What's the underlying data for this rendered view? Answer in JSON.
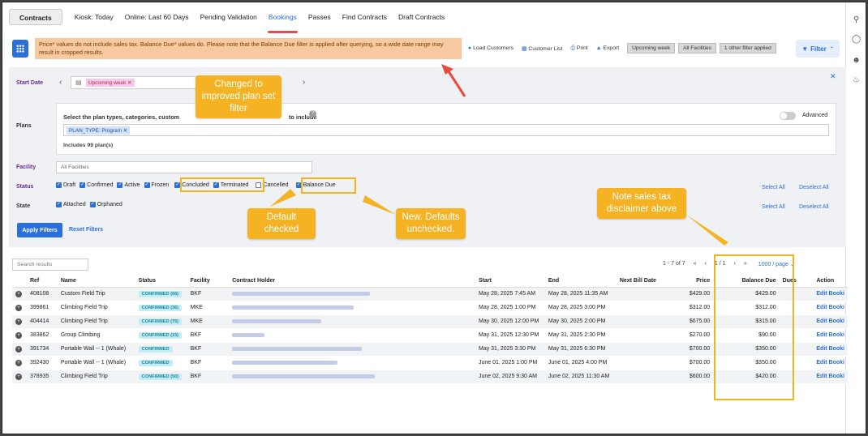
{
  "tabs": [
    "Contracts",
    "Kiosk: Today",
    "Online: Last 60 Days",
    "Pending Validation",
    "Bookings",
    "Passes",
    "Find Contracts",
    "Draft Contracts"
  ],
  "active_tab": "Bookings",
  "notice": "Price* values do not include sales tax. Balance Due* values do. Please note that the Balance Due filter is applied after querying, so a wide date range may result in cropped results.",
  "toolbar": {
    "load_customers": "Load Customers",
    "customer_list": "Customer List",
    "print": "Print",
    "export": "Export",
    "chips": [
      "Upcoming week",
      "All Facilities",
      "1 other filter applied"
    ],
    "filter_label": "Filter"
  },
  "filters": {
    "start_date_label": "Start Date",
    "start_date_value": "Upcoming week",
    "plans_label": "Plans",
    "plans_prompt": "Select the plan types, categories, custom",
    "plans_prompt_tail": "to include",
    "plan_tag": "PLAN_TYPE: Program",
    "plans_count": "Includes 99 plan(s)",
    "advanced_label": "Advanced",
    "facility_label": "Facility",
    "facility_value": "All Facilities",
    "status_label": "Status",
    "status_options": [
      {
        "label": "Draft",
        "checked": true
      },
      {
        "label": "Confirmed",
        "checked": true
      },
      {
        "label": "Active",
        "checked": true
      },
      {
        "label": "Frozen",
        "checked": true
      },
      {
        "label": "Concluded",
        "checked": true
      },
      {
        "label": "Terminated",
        "checked": true
      },
      {
        "label": "Cancelled",
        "checked": false
      },
      {
        "label": "Balance Due",
        "checked": true
      }
    ],
    "state_label": "State",
    "state_options": [
      {
        "label": "Attached",
        "checked": true
      },
      {
        "label": "Orphaned",
        "checked": true
      }
    ],
    "select_all": "Select All",
    "deselect_all": "Deselect All",
    "apply": "Apply Filters",
    "reset": "Reset Filters"
  },
  "results": {
    "search_placeholder": "Search results",
    "range": "1 - 7 of 7",
    "page": "1 / 1",
    "page_size": "1000 / page"
  },
  "columns": [
    "Ref",
    "Name",
    "Status",
    "Facility",
    "Contract Holder",
    "Start",
    "End",
    "Next Bill Date",
    "Price",
    "Balance Due",
    "Dues",
    "Action"
  ],
  "rows": [
    {
      "ref": "408108",
      "name": "Custom Field Trip",
      "status": "CONFIRMED (66)",
      "facility": "BKF",
      "start": "May 28, 2025 7:45 AM",
      "end": "May 28, 2025 11:35 AM",
      "price": "$429.00",
      "balance": "$429.00",
      "action": "Edit Booki"
    },
    {
      "ref": "399861",
      "name": "Climbing Field Trip",
      "status": "CONFIRMED (36)",
      "facility": "MKE",
      "start": "May 28, 2025 1:00 PM",
      "end": "May 28, 2025 3:00 PM",
      "price": "$312.00",
      "balance": "$312.00",
      "action": "Edit Booki"
    },
    {
      "ref": "404414",
      "name": "Climbing Field Trip",
      "status": "CONFIRMED (75)",
      "facility": "MKE",
      "start": "May 30, 2025 12:00 PM",
      "end": "May 30, 2025 2:00 PM",
      "price": "$675.00",
      "balance": "$315.00",
      "action": "Edit Booki"
    },
    {
      "ref": "383862",
      "name": "Group Climbing",
      "status": "CONFIRMED (15)",
      "facility": "BKF",
      "start": "May 31, 2025 12:30 PM",
      "end": "May 31, 2025 2:30 PM",
      "price": "$270.00",
      "balance": "$90.00",
      "action": "Edit Booki"
    },
    {
      "ref": "391734",
      "name": "Portable Wall -- 1 (Whale)",
      "status": "CONFIRMED",
      "facility": "BKF",
      "start": "May 31, 2025 3:30 PM",
      "end": "May 31, 2025 6:30 PM",
      "price": "$700.00",
      "balance": "$350.00",
      "action": "Edit Booki"
    },
    {
      "ref": "392430",
      "name": "Portable Wall -- 1 (Whale)",
      "status": "CONFIRMED",
      "facility": "BKF",
      "start": "June 01, 2025 1:00 PM",
      "end": "June 01, 2025 4:00 PM",
      "price": "$700.00",
      "balance": "$350.00",
      "action": "Edit Booki"
    },
    {
      "ref": "378935",
      "name": "Climbing Field Trip",
      "status": "CONFIRMED (50)",
      "facility": "BKF",
      "start": "June 02, 2025 9:30 AM",
      "end": "June 02, 2025 11:30 AM",
      "price": "$600.00",
      "balance": "$420.00",
      "action": "Edit Booki"
    }
  ],
  "callouts": {
    "plan_filter": "Changed to improved plan set filter",
    "default_checked": "Default checked",
    "new_defaults": "New. Defaults unchecked.",
    "sales_tax": "Note sales tax disclaimer above"
  },
  "colors": {
    "accent": "#2a6fdb",
    "callout": "#f5b324",
    "notice_bg": "#f7c9a0",
    "arrow": "#e84b3c"
  }
}
